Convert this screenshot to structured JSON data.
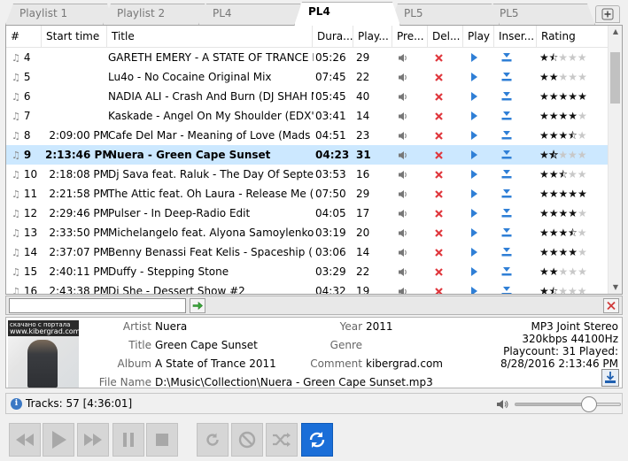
{
  "tabs": [
    {
      "label": "Playlist 1",
      "active": false
    },
    {
      "label": "Playlist 2",
      "active": false
    },
    {
      "label": "PL4",
      "active": false
    },
    {
      "label": "PL4",
      "active": true
    },
    {
      "label": "PL5",
      "active": false
    },
    {
      "label": "PL5",
      "active": false
    }
  ],
  "columns": {
    "num": "#",
    "start": "Start time",
    "title": "Title",
    "dur": "Dura...",
    "play": "Play...",
    "pre": "Pre...",
    "del": "Del...",
    "playbtn": "Play",
    "ins": "Inser...",
    "rating": "Rating"
  },
  "rows": [
    {
      "num": "4",
      "start": "",
      "title": "GARETH EMERY - A STATE OF TRANCE E...",
      "dur": "05:26",
      "plays": "29",
      "rating": 1.5,
      "selected": false
    },
    {
      "num": "5",
      "start": "",
      "title": "Lu4o - No Cocaine  Original Mix",
      "dur": "07:45",
      "plays": "22",
      "rating": 2,
      "selected": false
    },
    {
      "num": "6",
      "start": "",
      "title": "NADIA ALI - Crash And Burn (DJ SHAH M...",
      "dur": "05:45",
      "plays": "40",
      "rating": 5,
      "selected": false
    },
    {
      "num": "7",
      "start": "",
      "title": "Kaskade - Angel On My Shoulder (EDX's B...",
      "dur": "03:41",
      "plays": "14",
      "rating": 4,
      "selected": false
    },
    {
      "num": "8",
      "start": "2:09:00 PM",
      "title": "Cafe Del Mar - Meaning of Love (Mads Ar...",
      "dur": "04:51",
      "plays": "23",
      "rating": 3.5,
      "selected": false
    },
    {
      "num": "9",
      "start": "2:13:46 PM",
      "title": "Nuera - Green Cape Sunset",
      "dur": "04:23",
      "plays": "31",
      "rating": 1.5,
      "selected": true
    },
    {
      "num": "10",
      "start": "2:18:08 PM",
      "title": "Dj Sava feat. Raluk - The Day Of Septemb...",
      "dur": "03:53",
      "plays": "16",
      "rating": 2.5,
      "selected": false
    },
    {
      "num": "11",
      "start": "2:21:58 PM",
      "title": "The Attic feat. Oh Laura - Release Me (Pul...",
      "dur": "07:50",
      "plays": "29",
      "rating": 5,
      "selected": false
    },
    {
      "num": "12",
      "start": "2:29:46 PM",
      "title": "Pulser - In Deep-Radio Edit",
      "dur": "04:05",
      "plays": "17",
      "rating": 4,
      "selected": false
    },
    {
      "num": "13",
      "start": "2:33:50 PM",
      "title": "Michelangelo feat. Alyona Samoylenko - ...",
      "dur": "03:19",
      "plays": "20",
      "rating": 3.5,
      "selected": false
    },
    {
      "num": "14",
      "start": "2:37:07 PM",
      "title": "Benny Benassi Feat Kelis - Spaceship (Rad...",
      "dur": "03:06",
      "plays": "14",
      "rating": 4,
      "selected": false
    },
    {
      "num": "15",
      "start": "2:40:11 PM",
      "title": "Duffy - Stepping Stone",
      "dur": "03:29",
      "plays": "22",
      "rating": 2,
      "selected": false
    },
    {
      "num": "16",
      "start": "2:43:38 PM",
      "title": "Di She - Dessert Show #2",
      "dur": "04:32",
      "plays": "19",
      "rating": 1.5,
      "selected": false
    }
  ],
  "search": {
    "value": "",
    "placeholder": ""
  },
  "info": {
    "cover_caption_1": "скачано с портала",
    "cover_caption_2": "www.kibergrad.com",
    "labels": {
      "artist": "Artist",
      "title": "Title",
      "album": "Album",
      "file": "File Name",
      "year": "Year",
      "genre": "Genre",
      "comment": "Comment"
    },
    "artist": "Nuera",
    "title": "Green Cape Sunset",
    "album": "A State of Trance 2011",
    "file": "D:\\Music\\Collection\\Nuera - Green Cape Sunset.mp3",
    "year": "2011",
    "genre": "",
    "comment": "kibergrad.com",
    "format": "MP3 Joint Stereo",
    "bitrate": "320kbps 44100Hz",
    "playcount": "Playcount: 31  Played:",
    "played": "8/28/2016 2:13:46 PM"
  },
  "status": {
    "tracks": "Tracks: 57 [4:36:01]",
    "volume": 0.7
  },
  "colors": {
    "selected_row": "#cce8ff",
    "accent_blue": "#1a6ed8",
    "delete_red": "#e0383e",
    "play_blue": "#2f7fd6"
  },
  "icons": {
    "preview": "speaker-icon",
    "delete": "delete-x-icon",
    "play": "play-triangle-icon",
    "insert": "insert-download-icon"
  }
}
